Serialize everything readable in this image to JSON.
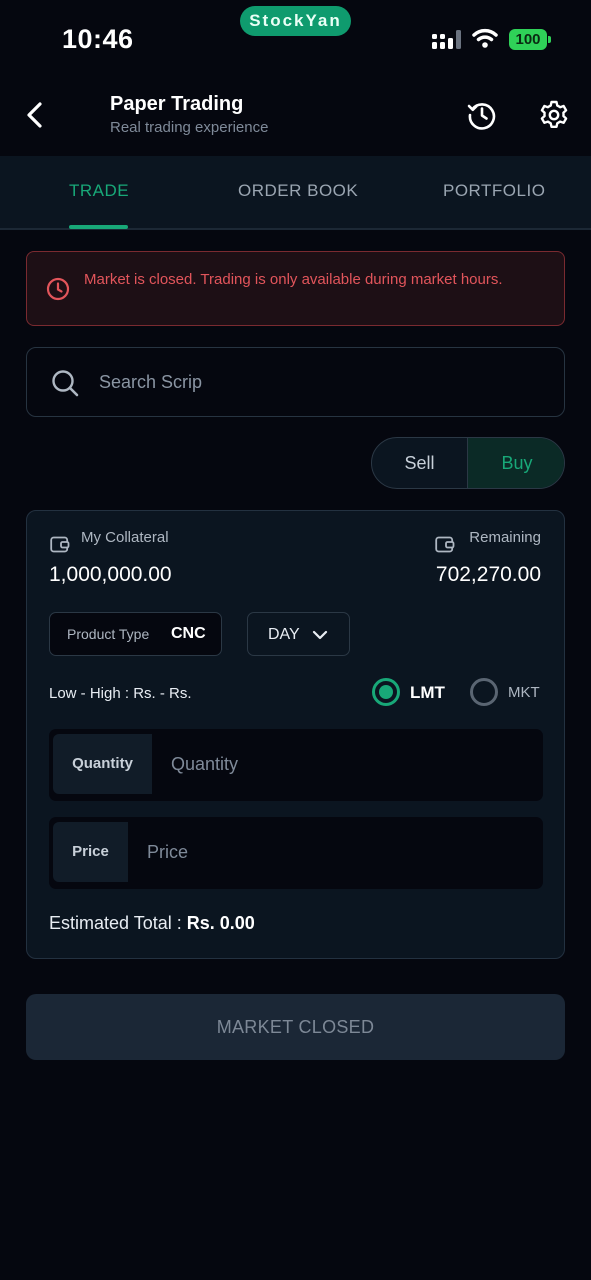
{
  "status_bar": {
    "time": "10:46",
    "app_pill": "StockYan",
    "battery": "100"
  },
  "header": {
    "title": "Paper Trading",
    "subtitle": "Real trading experience"
  },
  "tabs": [
    {
      "label": "TRADE",
      "active": true
    },
    {
      "label": "ORDER BOOK",
      "active": false
    },
    {
      "label": "PORTFOLIO",
      "active": false
    }
  ],
  "alert": {
    "message": "Market is closed. Trading is only available during market hours."
  },
  "search": {
    "placeholder": "Search Scrip",
    "value": ""
  },
  "side_toggle": {
    "sell_label": "Sell",
    "buy_label": "Buy",
    "selected": "Buy"
  },
  "funds": {
    "collateral_label": "My Collateral",
    "collateral_value": "1,000,000.00",
    "remaining_label": "Remaining",
    "remaining_value": "702,270.00"
  },
  "order": {
    "product_type_label": "Product Type",
    "product_type_value": "CNC",
    "validity_value": "DAY",
    "low_high_text": "Low - High : Rs. - Rs.",
    "order_types": {
      "lmt": "LMT",
      "mkt": "MKT",
      "selected": "LMT"
    },
    "quantity_label": "Quantity",
    "quantity_placeholder": "Quantity",
    "price_label": "Price",
    "price_placeholder": "Price",
    "estimated_total_label": "Estimated Total : ",
    "estimated_total_value": "Rs. 0.00"
  },
  "action_button": {
    "label": "MARKET CLOSED"
  },
  "colors": {
    "accent": "#18a878",
    "background": "#05070f",
    "alert": "#e2555b",
    "card": "#0b1520"
  },
  "icons": [
    "back-chevron-icon",
    "history-icon",
    "gear-icon",
    "clock-alert-icon",
    "search-icon",
    "wallet-icon",
    "chevron-down-icon",
    "signal-icon",
    "wifi-icon",
    "battery-icon"
  ]
}
